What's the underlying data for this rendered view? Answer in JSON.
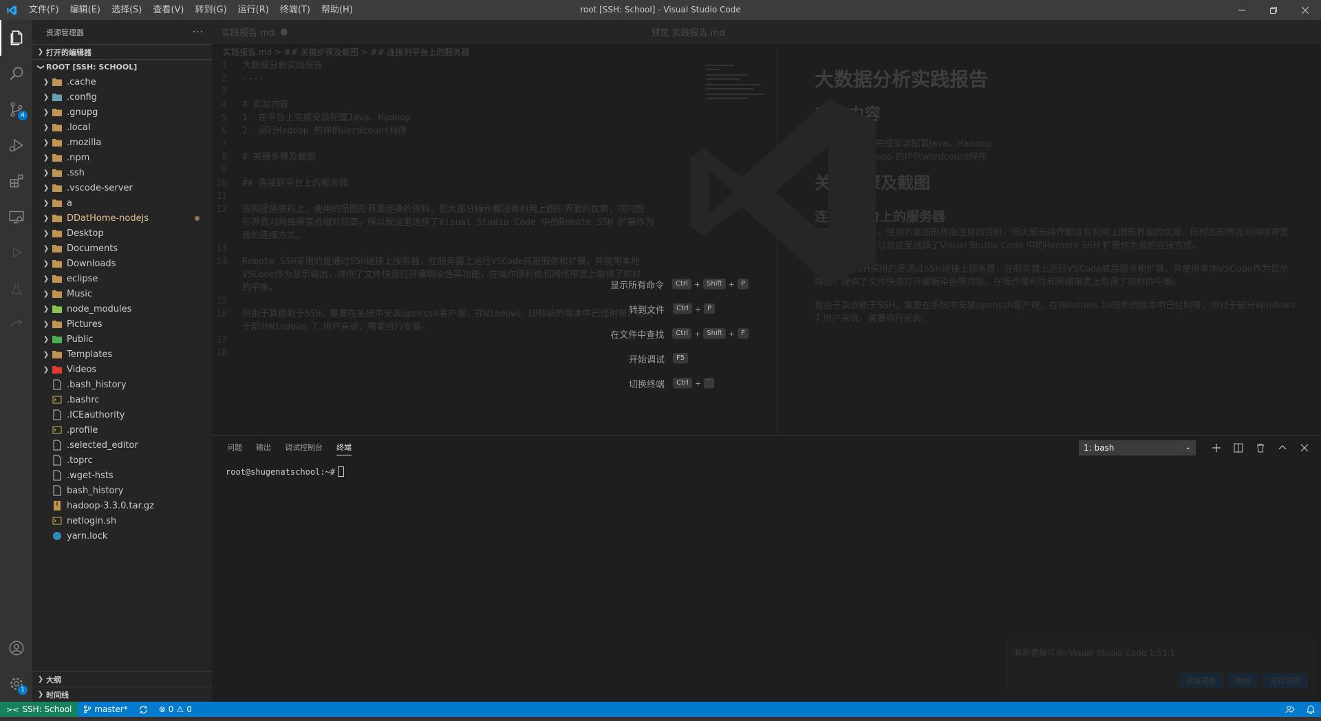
{
  "window": {
    "title": "root [SSH: School] - Visual Studio Code",
    "menu": [
      "文件(F)",
      "编辑(E)",
      "选择(S)",
      "查看(V)",
      "转到(G)",
      "运行(R)",
      "终端(T)",
      "帮助(H)"
    ]
  },
  "activity": {
    "scm_badge": "4",
    "settings_badge": "1"
  },
  "sidebar": {
    "title": "资源管理器",
    "open_editors": "打开的编辑器",
    "root": "ROOT [SSH: SCHOOL]",
    "folders": [
      {
        "name": ".cache",
        "color": "#c09553"
      },
      {
        "name": ".config",
        "color": "#6a9fb5"
      },
      {
        "name": ".gnupg",
        "color": "#c09553"
      },
      {
        "name": ".local",
        "color": "#c09553"
      },
      {
        "name": ".mozilla",
        "color": "#c09553"
      },
      {
        "name": ".npm",
        "color": "#c09553"
      },
      {
        "name": ".ssh",
        "color": "#c09553"
      },
      {
        "name": ".vscode-server",
        "color": "#c09553"
      },
      {
        "name": "a",
        "color": "#c09553"
      },
      {
        "name": "DDatHome-nodejs",
        "color": "#c09553"
      },
      {
        "name": "Desktop",
        "color": "#c09553"
      },
      {
        "name": "Documents",
        "color": "#c09553"
      },
      {
        "name": "Downloads",
        "color": "#c09553"
      },
      {
        "name": "eclipse",
        "color": "#c09553"
      },
      {
        "name": "Music",
        "color": "#c09553"
      },
      {
        "name": "node_modules",
        "color": "#8bc34a"
      },
      {
        "name": "Pictures",
        "color": "#c09553"
      },
      {
        "name": "Public",
        "color": "#4caf50"
      },
      {
        "name": "Templates",
        "color": "#c09553"
      },
      {
        "name": "Videos",
        "color": "#e53935"
      }
    ],
    "files": [
      ".bash_history",
      ".bashrc",
      ".ICEauthority",
      ".profile",
      ".selected_editor",
      ".toprc",
      ".wget-hsts",
      "bash_history",
      "hadoop-3.3.0.tar.gz",
      "netlogin.sh",
      "yarn.lock"
    ],
    "outline": "大纲",
    "timeline": "时间线"
  },
  "editor": {
    "tab": "实践报告.md",
    "preview_tab": "预览 实践报告.md",
    "breadcrumb": "实践报告.md > ## 关键步骤及截图 > ## 连接到平台上的服务器",
    "lines": [
      {
        "n": "1",
        "t": "大数据分析实践报告"
      },
      {
        "n": "2",
        "t": "----"
      },
      {
        "n": "3",
        "t": ""
      },
      {
        "n": "4",
        "t": "# 实验内容"
      },
      {
        "n": "5",
        "t": "1. 在平台上完成安装配置Java、Hadoop"
      },
      {
        "n": "6",
        "t": "2. 运行Hadoop 的样例wordcount程序"
      },
      {
        "n": "7",
        "t": ""
      },
      {
        "n": "8",
        "t": "# 关键步骤及截图"
      },
      {
        "n": "9",
        "t": ""
      },
      {
        "n": "10",
        "t": "## 连接到平台上的服务器"
      },
      {
        "n": "11",
        "t": ""
      },
      {
        "n": "12",
        "t": "按照提供资料上，使用的是图形界面连接的资料，但大部分操作都没有利用上图形界面的优势，同时图"
      },
      {
        "n": "",
        "t": "形界面对网络带宽也相对较高，所以我这里选择了Visual Studio Code 中的Remote SSH 扩展作为"
      },
      {
        "n": "",
        "t": "我的连接方式。"
      },
      {
        "n": "13",
        "t": ""
      },
      {
        "n": "14",
        "t": "Remote SSH采用的是通过SSH链接上服务器，在服务器上运行VSCode底层服务和扩展，并使用本地"
      },
      {
        "n": "",
        "t": "VSCode作为显示输出，提供了文件快速打开编辑染色等功能，在操作便利性和网络带宽上取得了较好"
      },
      {
        "n": "",
        "t": "的平衡。"
      },
      {
        "n": "15",
        "t": ""
      },
      {
        "n": "16",
        "t": "但由于其依赖于SSH，需要在系统中安装openssh客户端，在Windows 10较新的版本中已经附带，但对"
      },
      {
        "n": "",
        "t": "于部分Windows 7 用户来说，需要自行安装。"
      },
      {
        "n": "17",
        "t": ""
      },
      {
        "n": "18",
        "t": ""
      }
    ],
    "preview": {
      "h1": "大数据分析实践报告",
      "h2a": "实验内容",
      "li1": "1. 在平台上完成安装配置Java、Hadoop",
      "li2": "2. 运行Hadoop 的样例wordcount程序",
      "h2b": "关键步骤及截图",
      "h3": "连接到平台上的服务器",
      "p1": "按照提供资料上，使用的是图形界面连接的资料，但大部分操作都没有利用上图形界面的优势，同时图形界面对网络带宽也相对较高，所以我这里选择了Visual Studio Code 中的Remote SSH 扩展作为我的连接方式。",
      "p2": "Remote SSH采用的是通过SSH链接上服务器，在服务器上运行VSCode底层服务和扩展，并使用本地VSCode作为显示输出，提供了文件快速打开编辑染色等功能，在操作便利性和网络带宽上取得了较好的平衡。",
      "p3": "但由于其依赖于SSH，需要在系统中安装openssh客户端，在Windows 10较新的版本中已经附带，但对于部分Windows 7 用户来说，需要自行安装。"
    }
  },
  "welcome": [
    {
      "label": "显示所有命令",
      "keys": [
        "Ctrl",
        "Shift",
        "P"
      ]
    },
    {
      "label": "转到文件",
      "keys": [
        "Ctrl",
        "P"
      ]
    },
    {
      "label": "在文件中查找",
      "keys": [
        "Ctrl",
        "Shift",
        "F"
      ]
    },
    {
      "label": "开始调试",
      "keys": [
        "F5"
      ]
    },
    {
      "label": "切换终端",
      "keys": [
        "Ctrl",
        "`"
      ]
    }
  ],
  "panel": {
    "tabs": [
      "问题",
      "输出",
      "调试控制台",
      "终端"
    ],
    "terminal_select": "1: bash",
    "prompt": "root@shugenatschool:~#"
  },
  "notification": {
    "text": "有新更新可用: Visual Studio Code 1.51.1",
    "actions": [
      "安装更新",
      "稍后",
      "发行说明"
    ]
  },
  "statusbar": {
    "remote": "SSH: School",
    "branch": "master*",
    "errors": "0",
    "warnings": "0"
  }
}
